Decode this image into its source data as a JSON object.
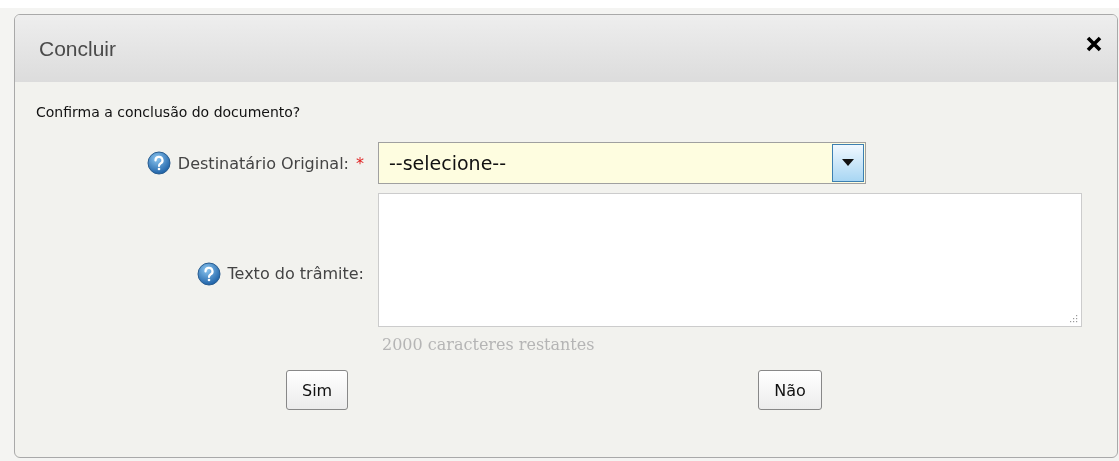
{
  "dialog": {
    "title": "Concluir"
  },
  "question": "Confirma a conclusão do documento?",
  "fields": [
    {
      "kind": "select",
      "label": "Destinatário Original:",
      "required_mark": "*",
      "value": "--selecione--"
    },
    {
      "kind": "textarea",
      "label": "Texto do trâmite:",
      "counter": "2000 caracteres restantes"
    }
  ],
  "buttons": [
    "Sim",
    "Não"
  ]
}
